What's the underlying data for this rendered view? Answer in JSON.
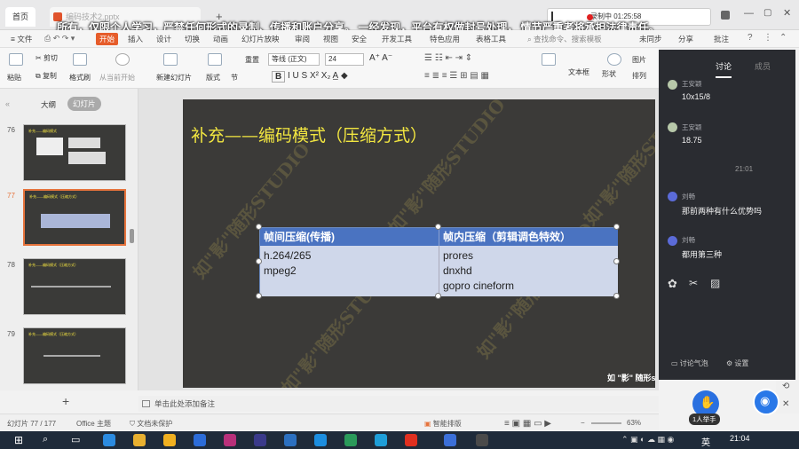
{
  "titlebar": {
    "home_tab": "首页",
    "doc_tab": "编码技术2.pptx",
    "new_tab": "+",
    "recording_label": "录制中 01:25:58"
  },
  "notice": "所有，仅限个人学习，严禁任何形式的录制、传播和账户分享。 一经发现，平台有权做封号处理， 情节严重者将承担法律责任。",
  "menubar": {
    "file": "文件",
    "items": [
      "开始",
      "插入",
      "设计",
      "切换",
      "动画",
      "幻灯片放映",
      "审阅",
      "视图",
      "安全",
      "开发工具",
      "特色应用",
      "表格工具"
    ],
    "search": "查找命令、搜索模板",
    "right_items": [
      "未同步",
      "分享",
      "批注"
    ]
  },
  "ribbon": {
    "paste": "粘贴",
    "cut": "剪切",
    "copy": "复制",
    "format_painter": "格式刷",
    "from_current": "从当前开始",
    "new_slide": "新建幻灯片",
    "layout": "版式",
    "section": "节",
    "reset": "重置",
    "font_name": "等线 (正文)",
    "font_size": "24",
    "bold": "B",
    "textbox": "文本框",
    "shape": "形状",
    "arrange": "排列",
    "picture": "图片"
  },
  "left_pane": {
    "outline_tab": "大纲",
    "slides_tab": "幻灯片",
    "thumbnails": [
      {
        "num": "76",
        "title": "补充——编码模式",
        "selected": false
      },
      {
        "num": "77",
        "title": "补充——编码模式（压缩方式）",
        "selected": true
      },
      {
        "num": "78",
        "title": "补充——编码模式（压缩方式）",
        "selected": false
      },
      {
        "num": "79",
        "title": "补充——编码模式（压缩方式）",
        "selected": false
      }
    ],
    "add_button": "+"
  },
  "slide": {
    "title": "补充——编码模式（压缩方式）",
    "watermark": "如\"影\"随形STUDIO",
    "table": {
      "headers": [
        "帧间压缩(传播)",
        "帧内压缩（剪辑调色特效）"
      ],
      "col1": [
        "h.264/265",
        "mpeg2"
      ],
      "col2": [
        "prores",
        "dnxhd",
        "gopro cineform"
      ]
    },
    "logo": "如 \"影\" 随形studio"
  },
  "notes_placeholder": "单击此处添加备注",
  "statusbar": {
    "slide_count": "幻灯片 77 / 177",
    "theme": "Office 主题",
    "doc_protect": "文档未保护",
    "smart_layout": "智能排版",
    "zoom": "63%"
  },
  "chat": {
    "tabs": [
      "讨论",
      "成员"
    ],
    "messages": [
      {
        "user": "王安颖",
        "text": "10x15/8",
        "color": "#b7c8a9"
      },
      {
        "user": "王安颖",
        "text": "18.75",
        "color": "#b7c8a9"
      },
      {
        "user": "刘畅",
        "text": "那前两种有什么优势吗",
        "color": "#5b6bd8"
      },
      {
        "user": "刘畅",
        "text": "都用第三种",
        "color": "#5b6bd8"
      }
    ],
    "time": "21:01",
    "footer_left": "讨论气泡",
    "footer_right": "设置",
    "raise_hand": "1人举手"
  },
  "taskbar": {
    "time": "21:04",
    "lang": "英"
  }
}
